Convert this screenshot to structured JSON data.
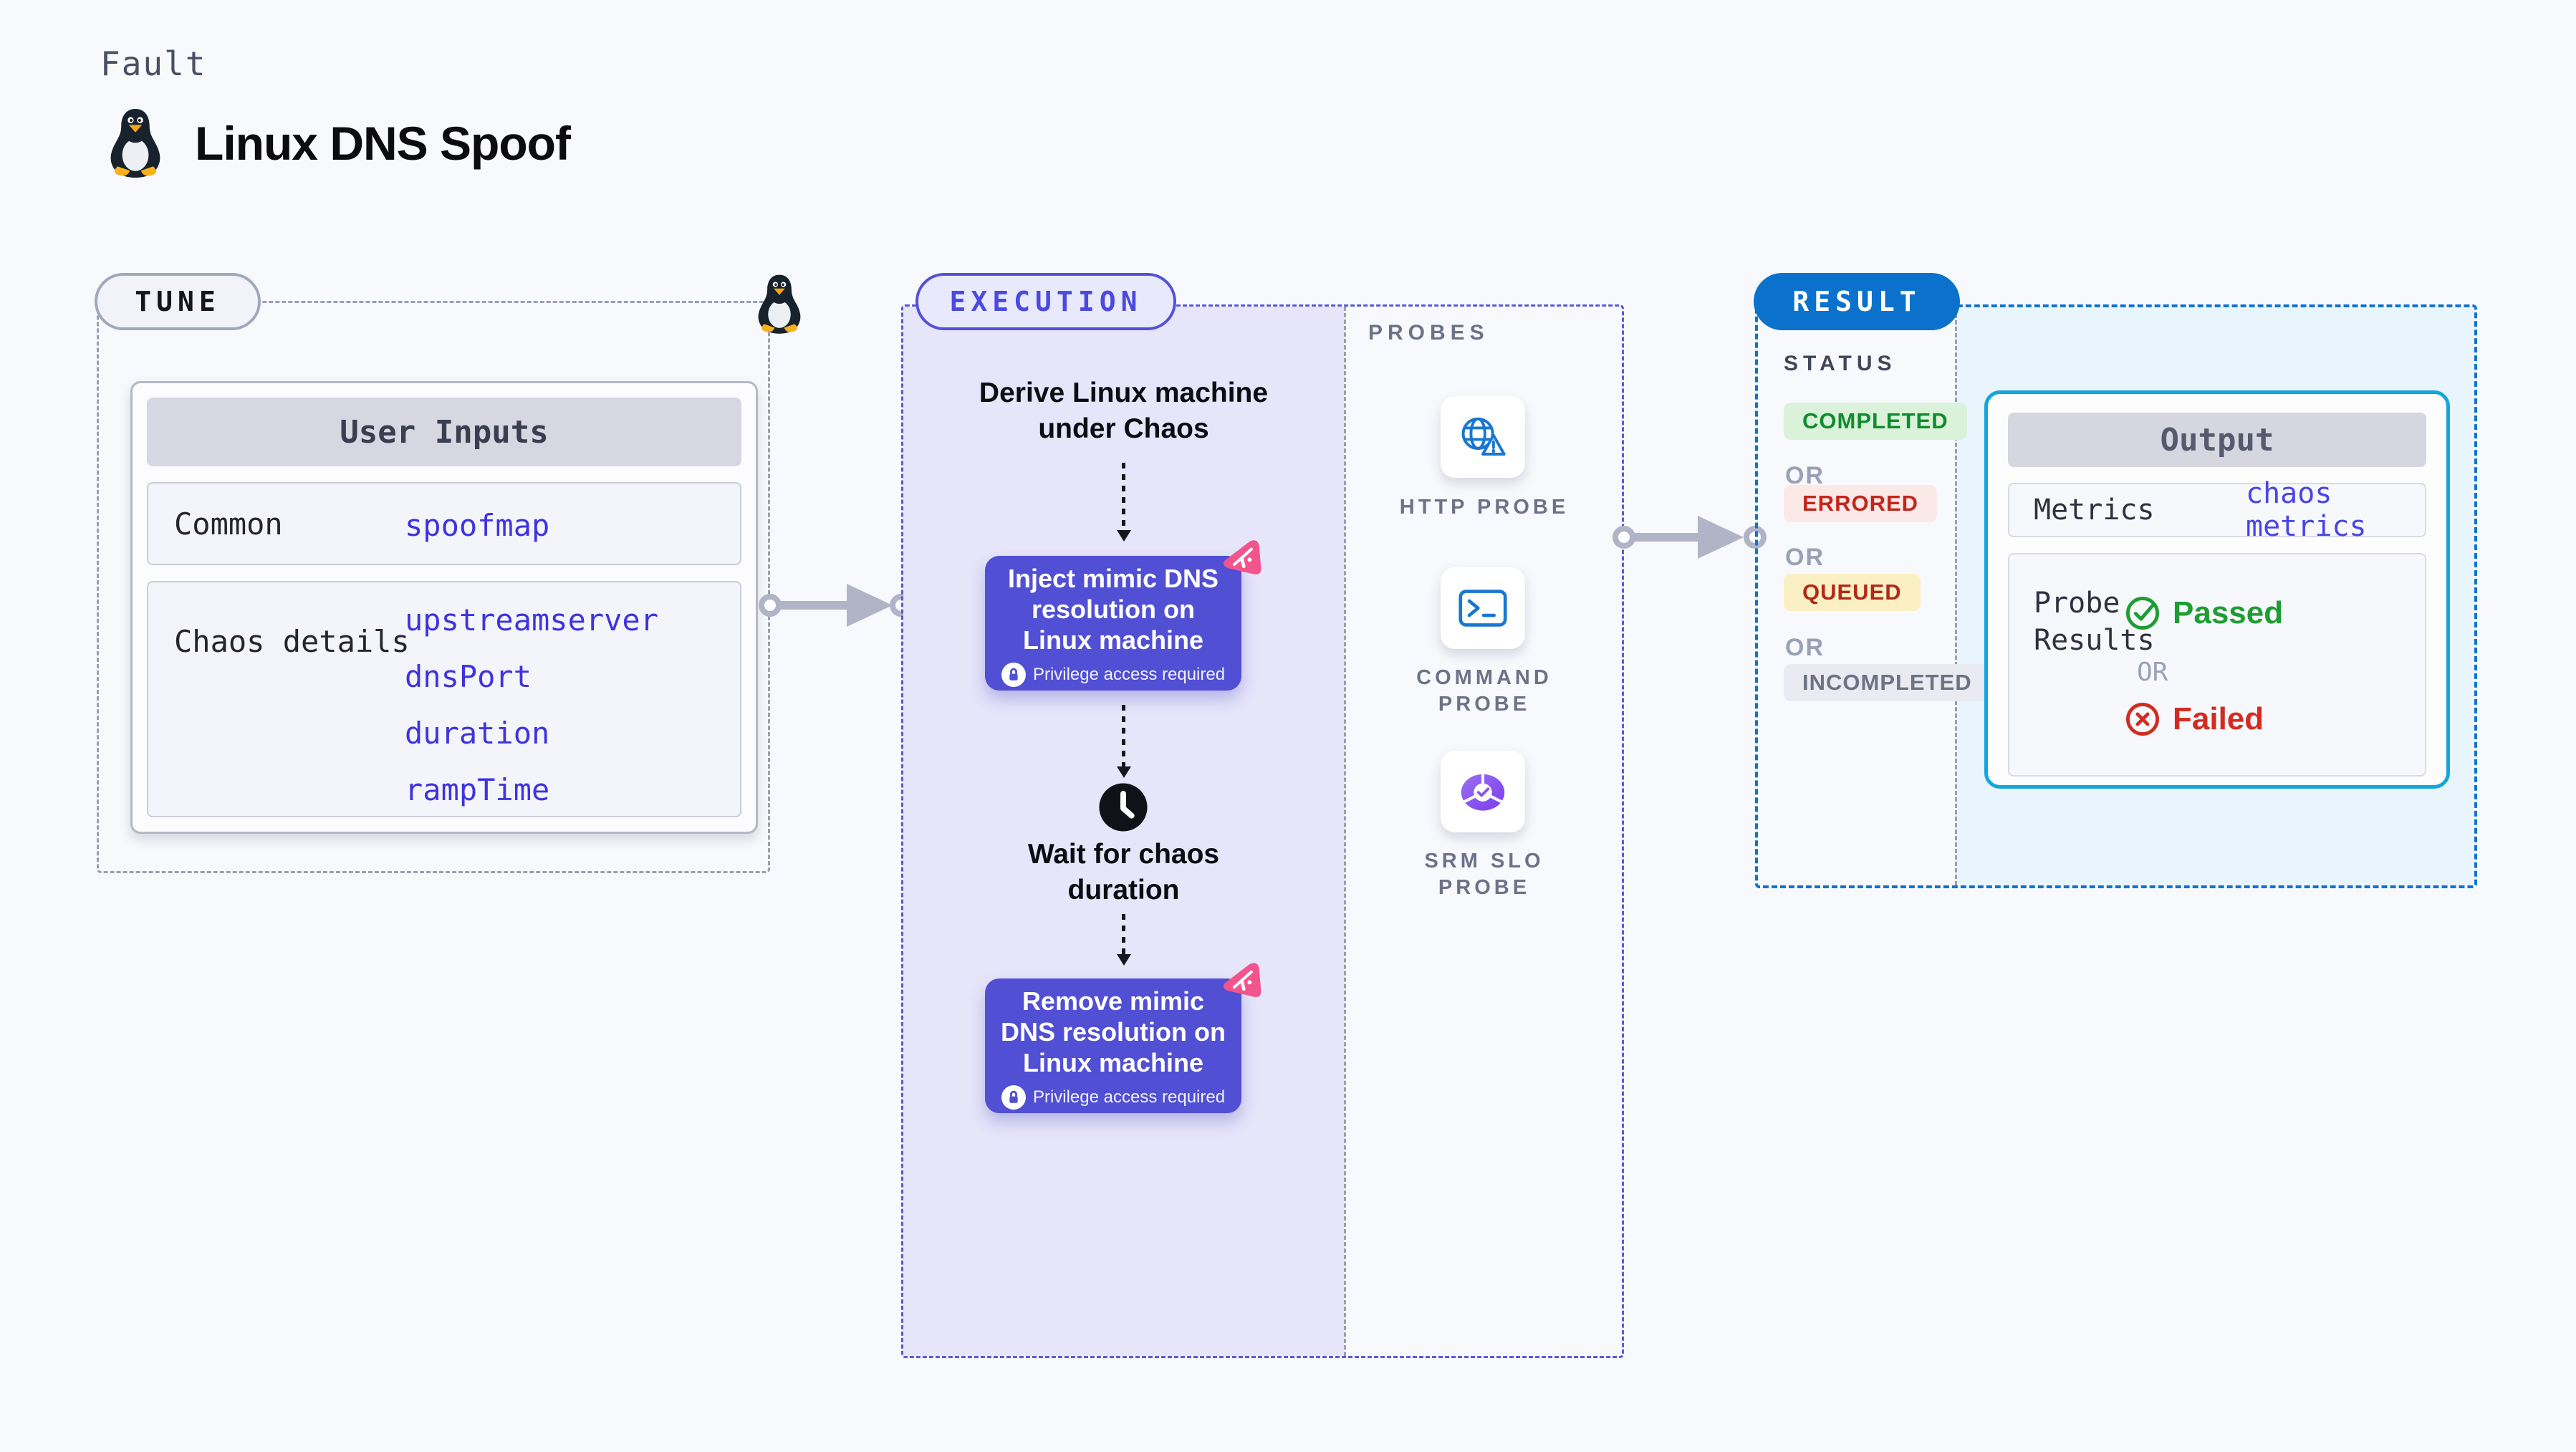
{
  "header": {
    "kicker": "Fault",
    "title": "Linux DNS Spoof"
  },
  "colors": {
    "accent_indigo": "#5351d6",
    "accent_blue": "#0a72cc",
    "accent_cyan": "#14a5dc",
    "node_fill": "#514fd4",
    "lavender_panel": "#e6e5fa",
    "result_panel": "#e8f5fc",
    "value_blue": "#3f33e0",
    "passed_green": "#1d9e32",
    "failed_red": "#d32b20",
    "completed_green": "#108c2f",
    "errored_red": "#c4251c",
    "queued_red": "#b02a18",
    "incompleted_gray": "#6d7284",
    "pink_logo": "#f2548c"
  },
  "tune": {
    "badge": "TUNE",
    "card_title": "User Inputs",
    "rows": [
      {
        "label": "Common",
        "values": [
          "spoofmap"
        ]
      },
      {
        "label": "Chaos details",
        "values": [
          "upstreamserver",
          "dnsPort",
          "duration",
          "rampTime"
        ]
      }
    ]
  },
  "execution": {
    "badge": "EXECUTION",
    "derive_line1": "Derive Linux machine",
    "derive_line2": "under Chaos",
    "inject_title": "Inject mimic DNS resolution on Linux machine",
    "privilege_note": "Privilege access required",
    "wait_line1": "Wait for chaos",
    "wait_line2": "duration",
    "remove_title": "Remove mimic DNS resolution on Linux machine"
  },
  "probes": {
    "title": "PROBES",
    "http_label": "HTTP PROBE",
    "command_line1": "COMMAND",
    "command_line2": "PROBE",
    "srm_line1": "SRM SLO",
    "srm_line2": "PROBE"
  },
  "result": {
    "badge": "RESULT",
    "status_title": "STATUS",
    "or_label": "OR",
    "statuses": [
      "COMPLETED",
      "ERRORED",
      "QUEUED",
      "INCOMPLETED"
    ],
    "output": {
      "title": "Output",
      "metrics_label": "Metrics",
      "metrics_value": "chaos metrics",
      "probe_results_line1": "Probe",
      "probe_results_line2": "Results",
      "passed": "Passed",
      "failed": "Failed"
    }
  }
}
